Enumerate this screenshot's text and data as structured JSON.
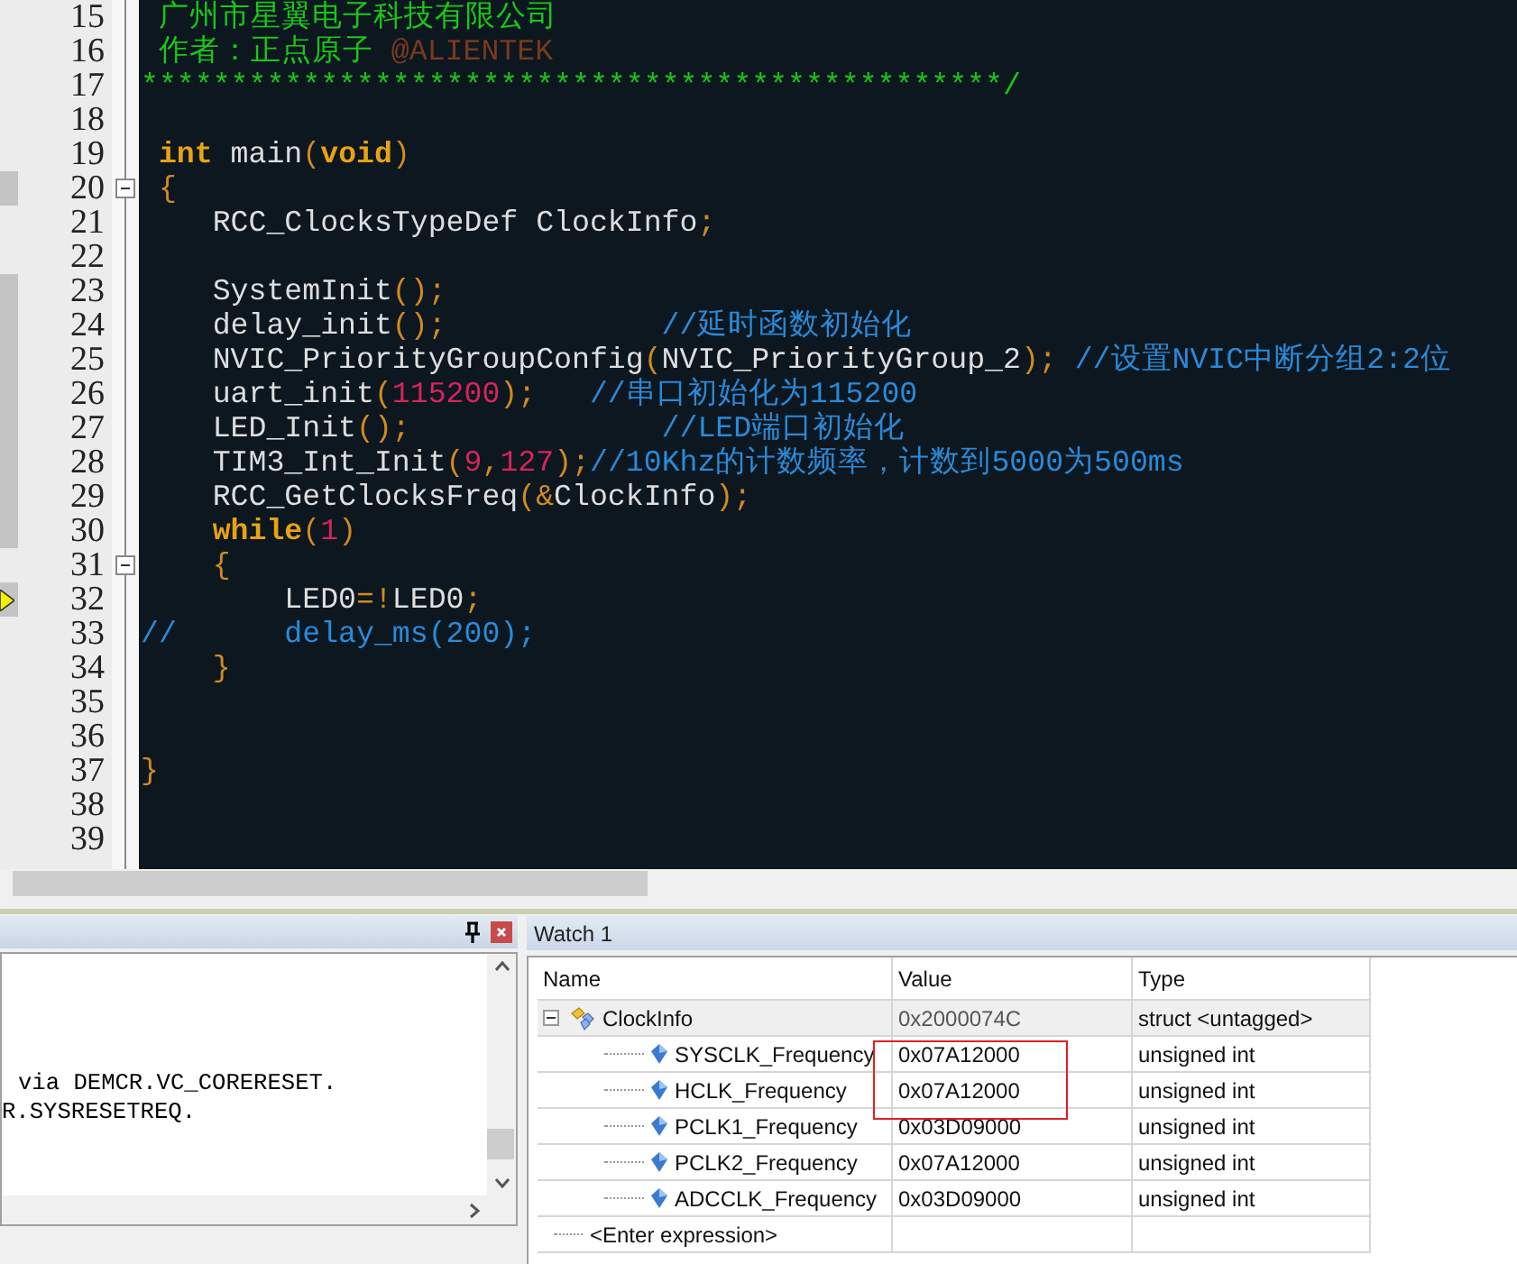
{
  "editor": {
    "lines": [
      {
        "number": "15",
        "executed": false,
        "current": false,
        "foldable": false,
        "tokens": [
          {
            "kind": "banner",
            "text": " 广州市星翼电子科技有限公司"
          }
        ]
      },
      {
        "number": "16",
        "executed": false,
        "current": false,
        "foldable": false,
        "tokens": [
          {
            "kind": "banner",
            "text": " 作者：正点原子 "
          },
          {
            "kind": "author",
            "text": "@ALIENTEK"
          }
        ]
      },
      {
        "number": "17",
        "executed": false,
        "current": false,
        "foldable": false,
        "tokens": [
          {
            "kind": "banner",
            "text": "************************************************/"
          }
        ]
      },
      {
        "number": "18",
        "executed": false,
        "current": false,
        "foldable": false
      },
      {
        "number": "19",
        "executed": false,
        "current": false,
        "foldable": false,
        "tokens": [
          {
            "kind": "keyword",
            "text": " int"
          },
          {
            "kind": "plain",
            "text": " main"
          },
          {
            "kind": "punct",
            "text": "("
          },
          {
            "kind": "keyword",
            "text": "void"
          },
          {
            "kind": "punct",
            "text": ")"
          }
        ]
      },
      {
        "number": "20",
        "executed": true,
        "current": false,
        "foldable": true,
        "tokens": [
          {
            "kind": "punct",
            "text": " {"
          }
        ]
      },
      {
        "number": "21",
        "executed": false,
        "current": false,
        "foldable": false,
        "tokens": [
          {
            "kind": "plain",
            "text": "    RCC_ClocksTypeDef ClockInfo"
          },
          {
            "kind": "punct",
            "text": ";"
          }
        ]
      },
      {
        "number": "22",
        "executed": false,
        "current": false,
        "foldable": false
      },
      {
        "number": "23",
        "executed": true,
        "current": false,
        "foldable": false,
        "tokens": [
          {
            "kind": "plain",
            "text": "    SystemInit"
          },
          {
            "kind": "punct",
            "text": "();"
          }
        ]
      },
      {
        "number": "24",
        "executed": true,
        "current": false,
        "foldable": false,
        "tokens": [
          {
            "kind": "plain",
            "text": "    delay_init"
          },
          {
            "kind": "punct",
            "text": "();"
          },
          {
            "kind": "comment",
            "text": "            //延时函数初始化"
          }
        ]
      },
      {
        "number": "25",
        "executed": true,
        "current": false,
        "foldable": false,
        "tokens": [
          {
            "kind": "plain",
            "text": "    NVIC_PriorityGroupConfig"
          },
          {
            "kind": "punct",
            "text": "("
          },
          {
            "kind": "plain",
            "text": "NVIC_PriorityGroup_2"
          },
          {
            "kind": "punct",
            "text": "); "
          },
          {
            "kind": "comment",
            "text": "//设置NVIC中断分组2:2位"
          }
        ]
      },
      {
        "number": "26",
        "executed": true,
        "current": false,
        "foldable": false,
        "tokens": [
          {
            "kind": "plain",
            "text": "    uart_init"
          },
          {
            "kind": "punct",
            "text": "("
          },
          {
            "kind": "number",
            "text": "115200"
          },
          {
            "kind": "punct",
            "text": ");"
          },
          {
            "kind": "comment",
            "text": "   //串口初始化为115200"
          }
        ]
      },
      {
        "number": "27",
        "executed": true,
        "current": false,
        "foldable": false,
        "tokens": [
          {
            "kind": "plain",
            "text": "    LED_Init"
          },
          {
            "kind": "punct",
            "text": "();"
          },
          {
            "kind": "comment",
            "text": "              //LED端口初始化"
          }
        ]
      },
      {
        "number": "28",
        "executed": true,
        "current": false,
        "foldable": false,
        "tokens": [
          {
            "kind": "plain",
            "text": "    TIM3_Int_Init"
          },
          {
            "kind": "punct",
            "text": "("
          },
          {
            "kind": "number",
            "text": "9"
          },
          {
            "kind": "punct",
            "text": ","
          },
          {
            "kind": "number",
            "text": "127"
          },
          {
            "kind": "punct",
            "text": ");"
          },
          {
            "kind": "comment",
            "text": "//10Khz的计数频率，计数到5000为500ms"
          }
        ]
      },
      {
        "number": "29",
        "executed": true,
        "current": false,
        "foldable": false,
        "tokens": [
          {
            "kind": "plain",
            "text": "    RCC_GetClocksFreq"
          },
          {
            "kind": "punct",
            "text": "(&"
          },
          {
            "kind": "plain",
            "text": "ClockInfo"
          },
          {
            "kind": "punct",
            "text": ");"
          }
        ]
      },
      {
        "number": "30",
        "executed": true,
        "current": false,
        "foldable": false,
        "tokens": [
          {
            "kind": "keyword",
            "text": "    while"
          },
          {
            "kind": "punct",
            "text": "("
          },
          {
            "kind": "number",
            "text": "1"
          },
          {
            "kind": "punct",
            "text": ")"
          }
        ]
      },
      {
        "number": "31",
        "executed": false,
        "current": false,
        "foldable": true,
        "tokens": [
          {
            "kind": "punct",
            "text": "    {"
          }
        ]
      },
      {
        "number": "32",
        "executed": true,
        "current": true,
        "foldable": false,
        "tokens": [
          {
            "kind": "plain",
            "text": "        LED0"
          },
          {
            "kind": "punct",
            "text": "=!"
          },
          {
            "kind": "plain",
            "text": "LED0"
          },
          {
            "kind": "punct",
            "text": ";"
          }
        ]
      },
      {
        "number": "33",
        "executed": false,
        "current": false,
        "foldable": false,
        "tokens": [
          {
            "kind": "comment",
            "text": "//      delay_ms(200);"
          }
        ]
      },
      {
        "number": "34",
        "executed": false,
        "current": false,
        "foldable": false,
        "tokens": [
          {
            "kind": "punct",
            "text": "    }"
          }
        ]
      },
      {
        "number": "35",
        "executed": false,
        "current": false,
        "foldable": false
      },
      {
        "number": "36",
        "executed": false,
        "current": false,
        "foldable": false
      },
      {
        "number": "37",
        "executed": false,
        "current": false,
        "foldable": false,
        "tokens": [
          {
            "kind": "punct",
            "text": "}"
          }
        ]
      },
      {
        "number": "38",
        "executed": false,
        "current": false,
        "foldable": false
      },
      {
        "number": "39",
        "executed": false,
        "current": false,
        "foldable": false
      }
    ]
  },
  "output_panel": {
    "lines": [
      "via DEMCR.VC_CORERESET.",
      "R.SYSRESETREQ."
    ]
  },
  "watch": {
    "title": "Watch 1",
    "columns": [
      "Name",
      "Value",
      "Type"
    ],
    "items": [
      {
        "name": "ClockInfo",
        "value": "0x2000074C",
        "type": "struct <untagged>",
        "expanded": true,
        "selected": true,
        "children": [
          {
            "name": "SYSCLK_Frequency",
            "value": "0x07A12000",
            "type": "unsigned int",
            "selected": false
          },
          {
            "name": "HCLK_Frequency",
            "value": "0x07A12000",
            "type": "unsigned int",
            "selected": false
          },
          {
            "name": "PCLK1_Frequency",
            "value": "0x03D09000",
            "type": "unsigned int",
            "selected": false
          },
          {
            "name": "PCLK2_Frequency",
            "value": "0x07A12000",
            "type": "unsigned int",
            "selected": false
          },
          {
            "name": "ADCCLK_Frequency",
            "value": "0x03D09000",
            "type": "unsigned int",
            "selected": false
          }
        ]
      }
    ],
    "enter_row": "<Enter expression>"
  }
}
